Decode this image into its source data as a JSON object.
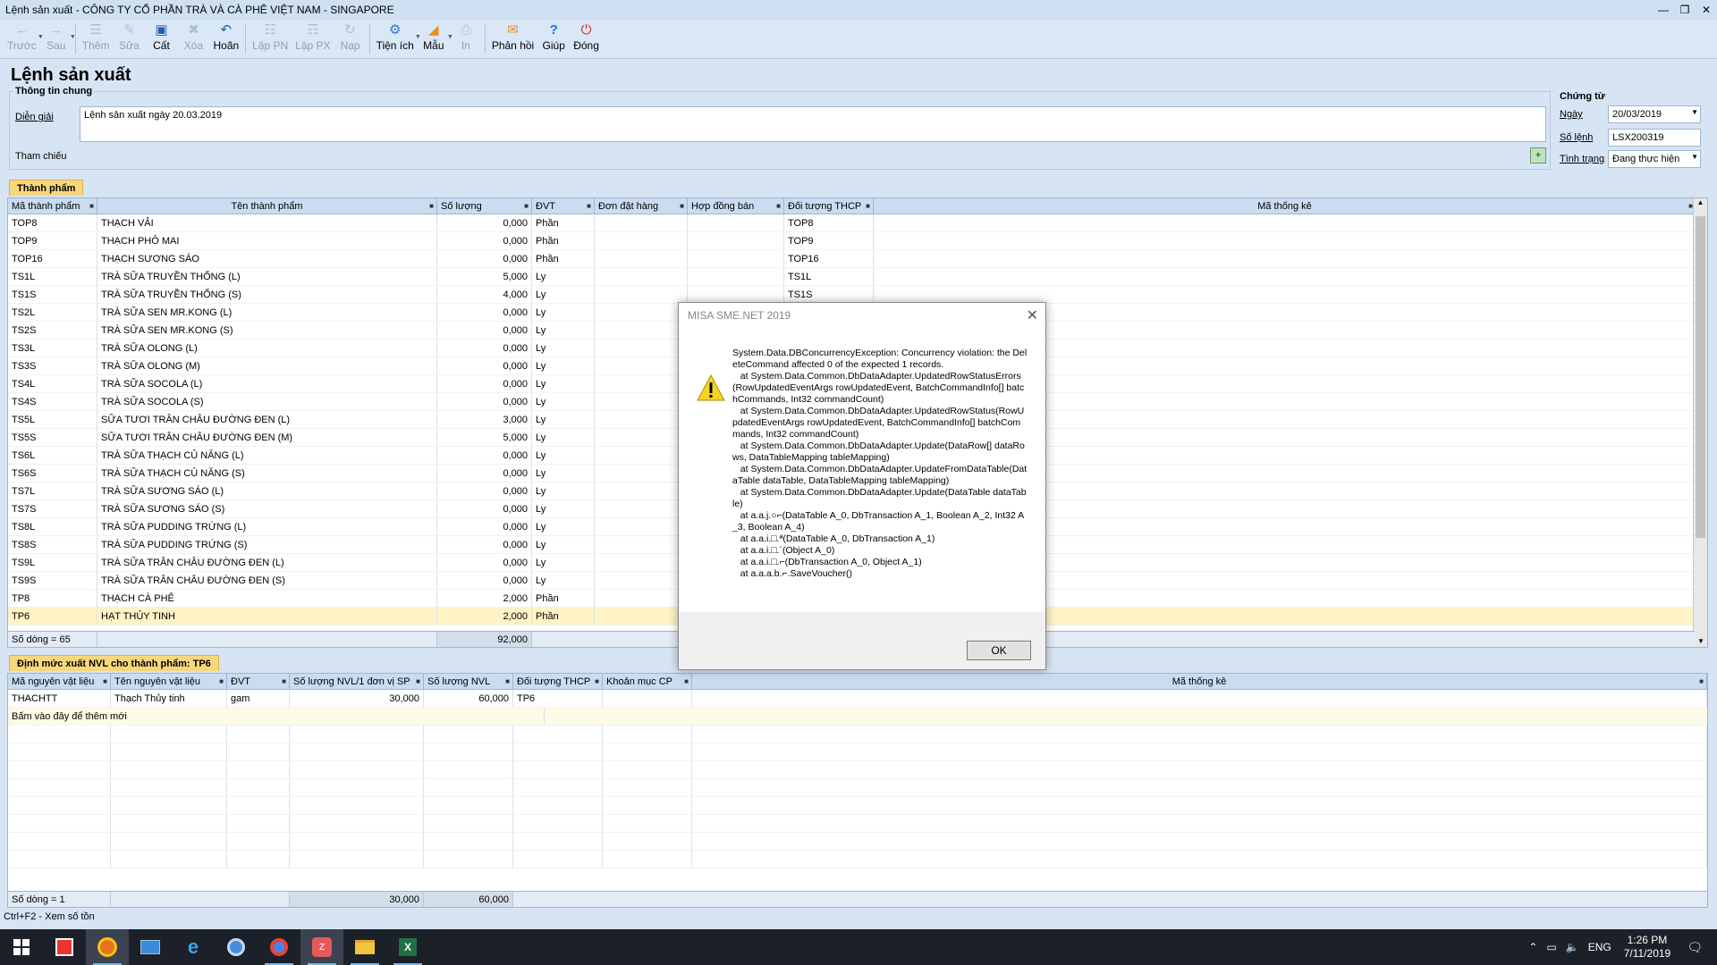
{
  "window": {
    "title": "Lệnh sản xuất - CÔNG TY CỔ PHẦN TRÀ VÀ CÀ PHÊ VIỆT NAM - SINGAPORE"
  },
  "toolbar": [
    {
      "label": "Trước",
      "icon": "arrow-left-icon",
      "disabled": true,
      "dropdown": true
    },
    {
      "label": "Sau",
      "icon": "arrow-right-icon",
      "disabled": true,
      "dropdown": true
    },
    {
      "label": "Thêm",
      "icon": "add-document-icon",
      "disabled": true
    },
    {
      "label": "Sửa",
      "icon": "edit-icon",
      "disabled": true
    },
    {
      "label": "Cất",
      "icon": "save-icon",
      "disabled": false
    },
    {
      "label": "Xóa",
      "icon": "delete-icon",
      "disabled": true
    },
    {
      "label": "Hoãn",
      "icon": "undo-icon",
      "disabled": false
    },
    {
      "label": "Lập PN",
      "icon": "receipt-icon",
      "disabled": true
    },
    {
      "label": "Lập PX",
      "icon": "issue-icon",
      "disabled": true
    },
    {
      "label": "Nạp",
      "icon": "reload-icon",
      "disabled": true
    },
    {
      "label": "Tiện ích",
      "icon": "utilities-icon",
      "disabled": false,
      "dropdown": true
    },
    {
      "label": "Mẫu",
      "icon": "template-icon",
      "disabled": false,
      "dropdown": true
    },
    {
      "label": "In",
      "icon": "print-icon",
      "disabled": true
    },
    {
      "label": "Phản hồi",
      "icon": "feedback-icon",
      "disabled": false
    },
    {
      "label": "Giúp",
      "icon": "help-icon",
      "disabled": false
    },
    {
      "label": "Đóng",
      "icon": "close-icon",
      "disabled": false
    }
  ],
  "page_title": "Lệnh sản xuất",
  "general": {
    "legend": "Thông tin chung",
    "desc_label": "Diễn giải",
    "desc_value": "Lệnh sản xuất ngày 20.03.2019",
    "ref_label": "Tham chiếu"
  },
  "voucher": {
    "legend": "Chứng từ",
    "date_label": "Ngày",
    "date_value": "20/03/2019",
    "number_label": "Số lệnh",
    "number_value": "LSX200319",
    "status_label": "Tình trạng",
    "status_value": "Đang thực hiện"
  },
  "products": {
    "tab": "Thành phẩm",
    "headers": [
      "Mã thành phẩm",
      "Tên thành phẩm",
      "Số lượng",
      "ĐVT",
      "Đơn đặt hàng",
      "Hợp đồng bán",
      "Đối tượng THCP",
      "Mã thống kê"
    ],
    "rows": [
      [
        "TOP8",
        "THẠCH VẢI",
        "0,000",
        "Phần",
        "",
        "",
        "TOP8",
        ""
      ],
      [
        "TOP9",
        "THẠCH PHÔ MAI",
        "0,000",
        "Phần",
        "",
        "",
        "TOP9",
        ""
      ],
      [
        "TOP16",
        "THẠCH SƯƠNG SÁO",
        "0,000",
        "Phần",
        "",
        "",
        "TOP16",
        ""
      ],
      [
        "TS1L",
        "TRÀ SỮA TRUYỀN THỐNG (L)",
        "5,000",
        "Ly",
        "",
        "",
        "TS1L",
        ""
      ],
      [
        "TS1S",
        "TRÀ SỮA TRUYỀN THỐNG (S)",
        "4,000",
        "Ly",
        "",
        "",
        "TS1S",
        ""
      ],
      [
        "TS2L",
        "TRÀ SỮA SEN MR.KONG (L)",
        "0,000",
        "Ly",
        "",
        "",
        "",
        ""
      ],
      [
        "TS2S",
        "TRÀ SỮA SEN MR.KONG (S)",
        "0,000",
        "Ly",
        "",
        "",
        "",
        ""
      ],
      [
        "TS3L",
        "TRÀ SỮA OLONG (L)",
        "0,000",
        "Ly",
        "",
        "",
        "",
        ""
      ],
      [
        "TS3S",
        "TRÀ SỮA OLONG (M)",
        "0,000",
        "Ly",
        "",
        "",
        "",
        ""
      ],
      [
        "TS4L",
        "TRÀ SỮA SOCOLA (L)",
        "0,000",
        "Ly",
        "",
        "",
        "",
        ""
      ],
      [
        "TS4S",
        "TRÀ SỮA SOCOLA (S)",
        "0,000",
        "Ly",
        "",
        "",
        "",
        ""
      ],
      [
        "TS5L",
        "SỮA TƯƠI TRÂN CHÂU ĐƯỜNG ĐEN (L)",
        "3,000",
        "Ly",
        "",
        "",
        "",
        ""
      ],
      [
        "TS5S",
        "SỮA TƯƠI TRÂN CHÂU ĐƯỜNG ĐEN (M)",
        "5,000",
        "Ly",
        "",
        "",
        "",
        ""
      ],
      [
        "TS6L",
        "TRÀ SỮA THẠCH CỦ NĂNG (L)",
        "0,000",
        "Ly",
        "",
        "",
        "",
        ""
      ],
      [
        "TS6S",
        "TRÀ SỮA THẠCH CỦ NĂNG (S)",
        "0,000",
        "Ly",
        "",
        "",
        "",
        ""
      ],
      [
        "TS7L",
        "TRÀ SỮA SƯƠNG SÁO (L)",
        "0,000",
        "Ly",
        "",
        "",
        "",
        ""
      ],
      [
        "TS7S",
        "TRÀ SỮA SƯƠNG SÁO (S)",
        "0,000",
        "Ly",
        "",
        "",
        "",
        ""
      ],
      [
        "TS8L",
        "TRÀ SỮA PUDDING TRỨNG (L)",
        "0,000",
        "Ly",
        "",
        "",
        "",
        ""
      ],
      [
        "TS8S",
        "TRÀ SỮA PUDDING TRỨNG (S)",
        "0,000",
        "Ly",
        "",
        "",
        "",
        ""
      ],
      [
        "TS9L",
        "TRÀ SỮA TRÂN CHÂU ĐƯỜNG ĐEN (L)",
        "0,000",
        "Ly",
        "",
        "",
        "",
        ""
      ],
      [
        "TS9S",
        "TRÀ SỮA TRÂN CHÂU ĐƯỜNG ĐEN (S)",
        "0,000",
        "Ly",
        "",
        "",
        "",
        ""
      ],
      [
        "TP8",
        "THẠCH CÀ PHÊ",
        "2,000",
        "Phần",
        "",
        "",
        "",
        ""
      ],
      [
        "TP6",
        "HẠT THỦY TINH",
        "2,000",
        "Phần",
        "",
        "",
        "",
        ""
      ]
    ],
    "selected_index": 22,
    "footer_count": "Số dòng = 65",
    "footer_total": "92,000"
  },
  "materials": {
    "tab": "Định mức xuất NVL cho thành phẩm: TP6",
    "headers": [
      "Mã nguyên vật liệu",
      "Tên nguyên vật liệu",
      "ĐVT",
      "Số lượng NVL/1 đơn vị SP",
      "Số lượng NVL",
      "Đối tượng THCP",
      "Khoản mục CP",
      "Mã thống kê"
    ],
    "rows": [
      [
        "THACHTT",
        "Thạch Thủy tinh",
        "gam",
        "30,000",
        "60,000",
        "TP6",
        "",
        ""
      ]
    ],
    "add_row": "Bấm vào đây để thêm mới",
    "footer_count": "Số dòng = 1",
    "footer_qty_per": "30,000",
    "footer_qty": "60,000"
  },
  "status_bar": "Ctrl+F2 - Xem số tồn",
  "dialog": {
    "title": "MISA SME.NET 2019",
    "icon": "warning-icon",
    "message": "System.Data.DBConcurrencyException: Concurrency violation: the DeleteCommand affected 0 of the expected 1 records.\n   at System.Data.Common.DbDataAdapter.UpdatedRowStatusErrors(RowUpdatedEventArgs rowUpdatedEvent, BatchCommandInfo[] batchCommands, Int32 commandCount)\n   at System.Data.Common.DbDataAdapter.UpdatedRowStatus(RowUpdatedEventArgs rowUpdatedEvent, BatchCommandInfo[] batchCommands, Int32 commandCount)\n   at System.Data.Common.DbDataAdapter.Update(DataRow[] dataRows, DataTableMapping tableMapping)\n   at System.Data.Common.DbDataAdapter.UpdateFromDataTable(DataTable dataTable, DataTableMapping tableMapping)\n   at System.Data.Common.DbDataAdapter.Update(DataTable dataTable)\n   at a.a.j.○⌐(DataTable A_0, DbTransaction A_1, Boolean A_2, Int32 A_3, Boolean A_4)\n   at a.a.i.□.ª(DataTable A_0, DbTransaction A_1)\n   at a.a.i.□.´(Object A_0)\n   at a.a.i.□.⌐(DbTransaction A_0, Object A_1)\n   at a.a.a.b.⌐.SaveVoucher()",
    "ok": "OK"
  },
  "taskbar": {
    "lang": "ENG",
    "time": "1:26 PM",
    "date": "7/11/2019"
  },
  "colors": {
    "accent": "#f8d77c",
    "header": "#cadcf1",
    "background": "#d6e4f4"
  }
}
